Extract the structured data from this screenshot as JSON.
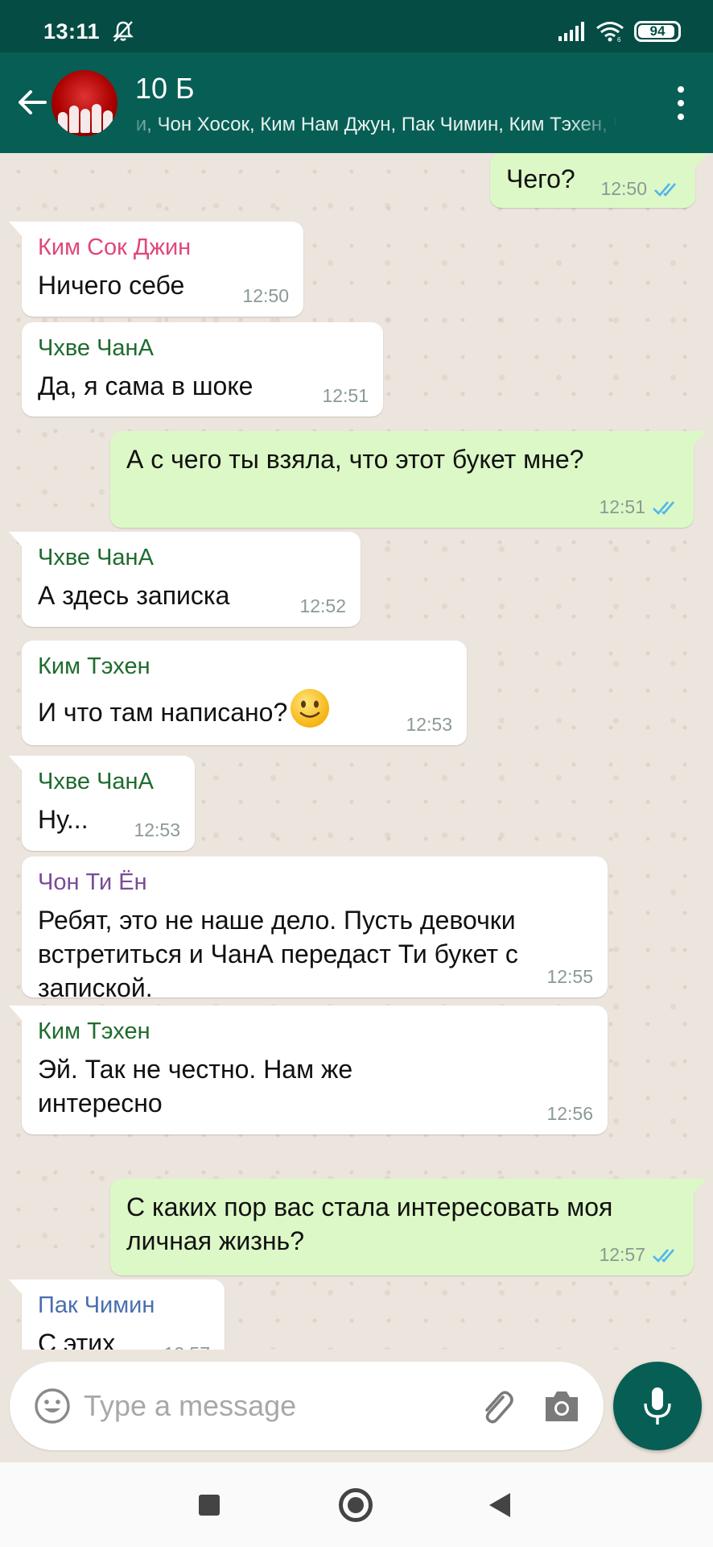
{
  "status_bar": {
    "time": "13:11",
    "battery": "94",
    "battery_level": 0.94
  },
  "header": {
    "title": "10 Б",
    "members": "ги, Чон Хосок, Ким Нам Джун, Пак Чимин, Ким Тэхен, Чон Чонгук, Вы"
  },
  "messages": [
    {
      "dir": "out",
      "text": "Чего?",
      "time": "12:50",
      "status": "read"
    },
    {
      "dir": "in",
      "sender": "Ким Сок Джин",
      "sender_color": "#e0477a",
      "text": "Ничего себе",
      "time": "12:50"
    },
    {
      "dir": "in",
      "sender": "Чхве ЧанА",
      "sender_color": "#1f6b2e",
      "text": "Да, я сама в шоке",
      "time": "12:51"
    },
    {
      "dir": "out",
      "text": "А с чего ты взяла, что этот букет мне?",
      "time": "12:51",
      "status": "read"
    },
    {
      "dir": "in",
      "sender": "Чхве ЧанА",
      "sender_color": "#1f6b2e",
      "text": "А здесь записка",
      "time": "12:52"
    },
    {
      "dir": "in",
      "sender": "Ким Тэхен",
      "sender_color": "#1f6b2e",
      "text": "И что там написано?",
      "emoji": "slightly-smiling-face",
      "time": "12:53"
    },
    {
      "dir": "in",
      "sender": "Чхве ЧанА",
      "sender_color": "#1f6b2e",
      "text": "Ну...",
      "time": "12:53"
    },
    {
      "dir": "in",
      "sender": "Чон Ти Ён",
      "sender_color": "#7a4a9a",
      "text": "Ребят, это не наше дело. Пусть девочки встретиться и ЧанА передаст Ти букет с запиской.",
      "time": "12:55"
    },
    {
      "dir": "in",
      "sender": "Ким Тэхен",
      "sender_color": "#1f6b2e",
      "text": "Эй. Так не честно. Нам же интересно",
      "time": "12:56"
    },
    {
      "dir": "out",
      "text": "С каких пор вас стала интересовать моя личная жизнь?",
      "time": "12:57",
      "status": "read"
    },
    {
      "dir": "in",
      "sender": "Пак Чимин",
      "sender_color": "#4a6fb0",
      "text": "С этих",
      "time": "12:57"
    }
  ],
  "composer": {
    "placeholder": "Type a message"
  },
  "colors": {
    "header": "#075e54",
    "status_bar": "#054d44",
    "outgoing_bubble": "#dcf8c6",
    "incoming_bubble": "#ffffff",
    "read_ticks": "#4fb6ec",
    "chat_background": "#ece5dd"
  }
}
